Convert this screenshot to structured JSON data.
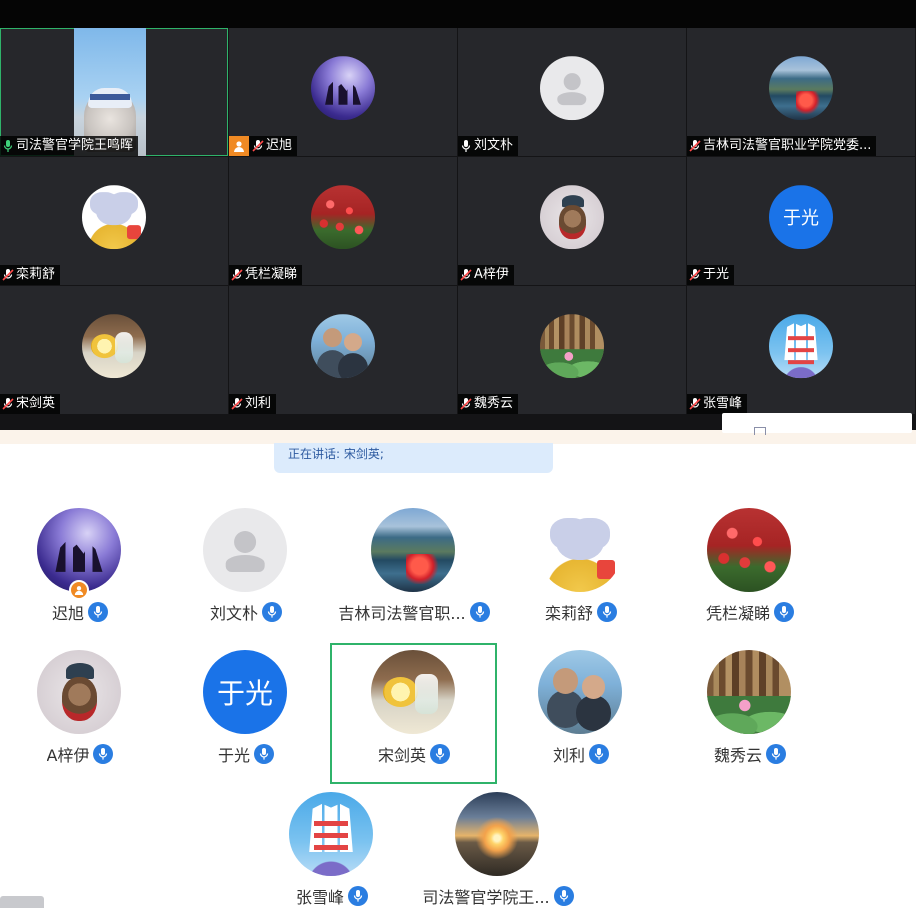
{
  "video_grid": {
    "tiles": [
      {
        "name": "司法警官学院王鸣晖",
        "mic": "on",
        "avatar": "video"
      },
      {
        "name": "迟旭",
        "mic": "off",
        "avatar": "purple",
        "host": true
      },
      {
        "name": "刘文朴",
        "mic": "on",
        "avatar": "gray"
      },
      {
        "name": "吉林司法警官职业学院党委...",
        "mic": "off",
        "avatar": "lake"
      },
      {
        "name": "栾莉舒",
        "mic": "off",
        "avatar": "mouse"
      },
      {
        "name": "凭栏凝睇",
        "mic": "off",
        "avatar": "tulip"
      },
      {
        "name": "A梓伊",
        "mic": "off",
        "avatar": "monkey"
      },
      {
        "name": "于光",
        "mic": "off",
        "avatar": "blue",
        "initials": "于光"
      },
      {
        "name": "宋剑英",
        "mic": "off",
        "avatar": "lemon"
      },
      {
        "name": "刘利",
        "mic": "off",
        "avatar": "couple"
      },
      {
        "name": "魏秀云",
        "mic": "off",
        "avatar": "lotus"
      },
      {
        "name": "张雪峰",
        "mic": "off",
        "avatar": "ship"
      }
    ]
  },
  "speaking": {
    "label": "正在讲话: 宋剑英;"
  },
  "participants": [
    {
      "name": "迟旭",
      "avatar": "purple",
      "host": true
    },
    {
      "name": "刘文朴",
      "avatar": "gray"
    },
    {
      "name": "吉林司法警官职...",
      "avatar": "lake"
    },
    {
      "name": "栾莉舒",
      "avatar": "mouse"
    },
    {
      "name": "凭栏凝睇",
      "avatar": "tulip"
    },
    {
      "name": "A梓伊",
      "avatar": "monkey"
    },
    {
      "name": "于光",
      "avatar": "blue",
      "initials": "于光"
    },
    {
      "name": "宋剑英",
      "avatar": "lemon",
      "speaking": true
    },
    {
      "name": "刘利",
      "avatar": "couple"
    },
    {
      "name": "魏秀云",
      "avatar": "lotus"
    },
    {
      "name": "张雪峰",
      "avatar": "ship"
    },
    {
      "name": "司法警官学院王...",
      "avatar": "sunset"
    }
  ],
  "colors": {
    "accent": "#2a7de1",
    "active_border": "#2fb36a",
    "host_badge": "#f08a24",
    "speaking_bg": "#dcebfc"
  }
}
